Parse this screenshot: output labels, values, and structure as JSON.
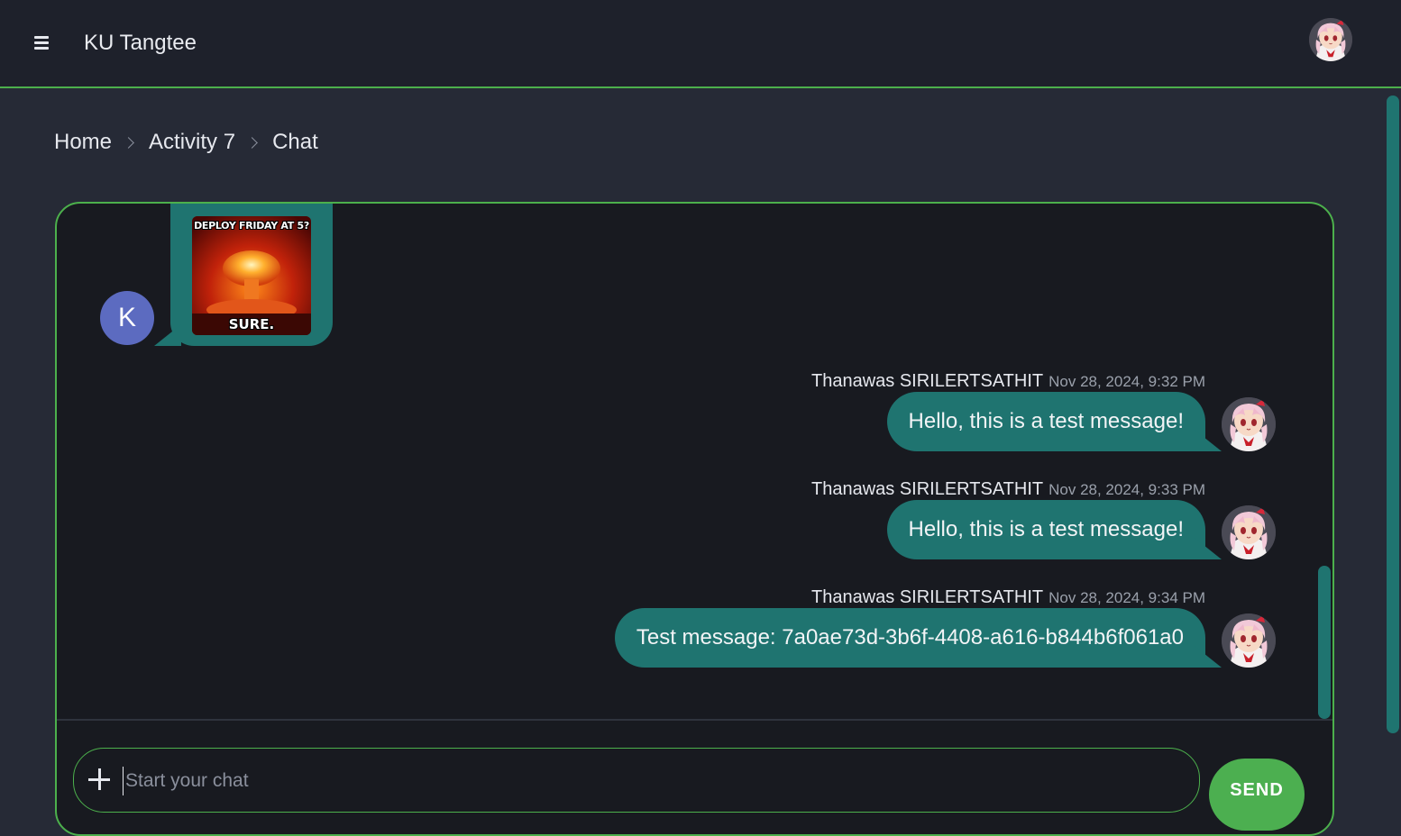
{
  "header": {
    "app_title": "KU Tangtee",
    "menu_icon": "hamburger-icon",
    "user_avatar": "anime-avatar"
  },
  "breadcrumb": {
    "items": [
      "Home",
      "Activity 7",
      "Chat"
    ]
  },
  "chat": {
    "incoming": {
      "avatar_letter": "K",
      "image_caption_top": "DEPLOY FRIDAY AT 5?",
      "image_caption_bottom": "SURE."
    },
    "messages": [
      {
        "sender": "Thanawas SIRILERTSATHIT",
        "time": "Nov 28, 2024, 9:32 PM",
        "text": "Hello, this is a test message!"
      },
      {
        "sender": "Thanawas SIRILERTSATHIT",
        "time": "Nov 28, 2024, 9:33 PM",
        "text": "Hello, this is a test message!"
      },
      {
        "sender": "Thanawas SIRILERTSATHIT",
        "time": "Nov 28, 2024, 9:34 PM",
        "text": "Test message: 7a0ae73d-3b6f-4408-a616-b844b6f061a0"
      }
    ]
  },
  "composer": {
    "placeholder": "Start your chat",
    "send_label": "SEND",
    "attach_icon": "plus-icon"
  },
  "colors": {
    "accent_green": "#4cb04c",
    "bubble_teal": "#1f7470",
    "k_avatar": "#5c6bc0"
  }
}
